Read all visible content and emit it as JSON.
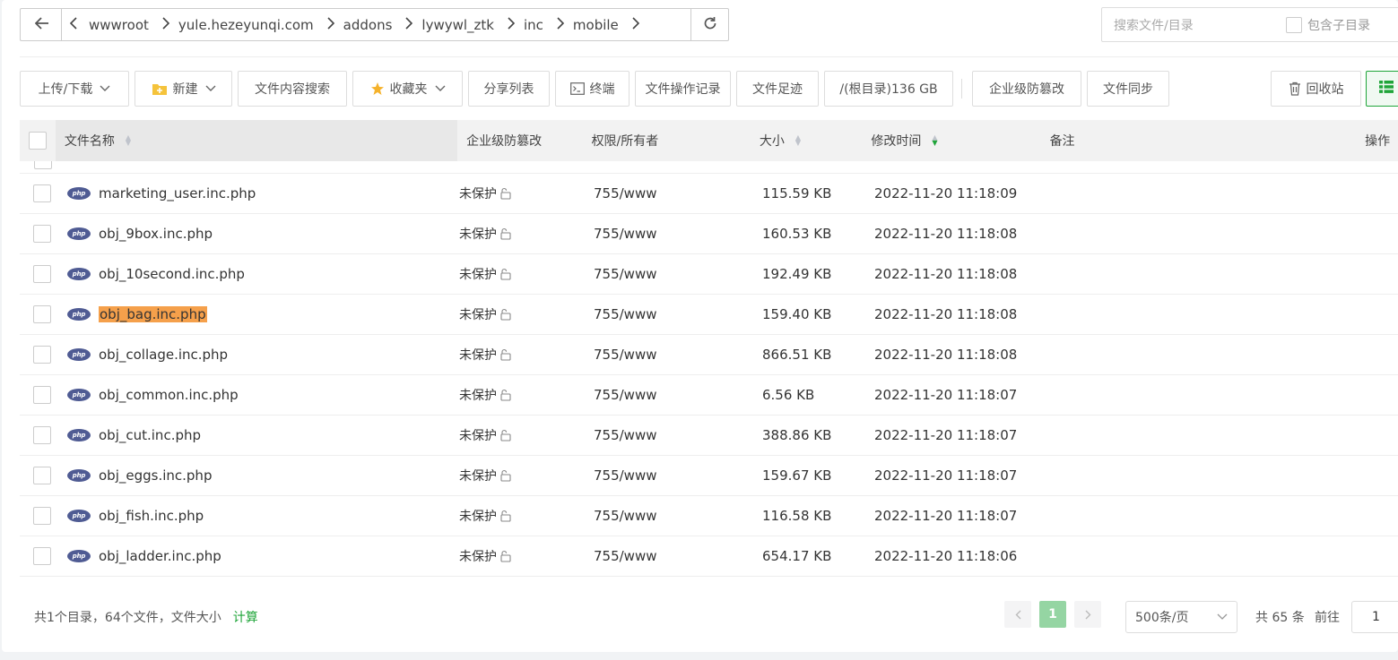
{
  "nav": {
    "path": [
      "wwwroot",
      "yule.hezeyunqi.com",
      "addons",
      "lywywl_ztk",
      "inc",
      "mobile"
    ],
    "search_placeholder": "搜索文件/目录",
    "include_subdir_label": "包含子目录"
  },
  "toolbar": {
    "upload": "上传/下载",
    "new": "新建",
    "content_search": "文件内容搜索",
    "favorites": "收藏夹",
    "share_list": "分享列表",
    "terminal": "终端",
    "op_log": "文件操作记录",
    "footprint": "文件足迹",
    "disk": "/(根目录)136 GB",
    "tamper": "企业级防篡改",
    "sync": "文件同步",
    "recycle": "回收站"
  },
  "table": {
    "headers": {
      "name": "文件名称",
      "protect": "企业级防篡改",
      "perm": "权限/所有者",
      "size": "大小",
      "mtime": "修改时间",
      "note": "备注",
      "op": "操作"
    },
    "rows": [
      {
        "name": "marketing_user.inc.php",
        "protect": "未保护",
        "perm": "755/www",
        "size": "115.59 KB",
        "mtime": "2022-11-20 11:18:09",
        "highlight": false
      },
      {
        "name": "obj_9box.inc.php",
        "protect": "未保护",
        "perm": "755/www",
        "size": "160.53 KB",
        "mtime": "2022-11-20 11:18:08",
        "highlight": false
      },
      {
        "name": "obj_10second.inc.php",
        "protect": "未保护",
        "perm": "755/www",
        "size": "192.49 KB",
        "mtime": "2022-11-20 11:18:08",
        "highlight": false
      },
      {
        "name": "obj_bag.inc.php",
        "protect": "未保护",
        "perm": "755/www",
        "size": "159.40 KB",
        "mtime": "2022-11-20 11:18:08",
        "highlight": true
      },
      {
        "name": "obj_collage.inc.php",
        "protect": "未保护",
        "perm": "755/www",
        "size": "866.51 KB",
        "mtime": "2022-11-20 11:18:08",
        "highlight": false
      },
      {
        "name": "obj_common.inc.php",
        "protect": "未保护",
        "perm": "755/www",
        "size": "6.56 KB",
        "mtime": "2022-11-20 11:18:07",
        "highlight": false
      },
      {
        "name": "obj_cut.inc.php",
        "protect": "未保护",
        "perm": "755/www",
        "size": "388.86 KB",
        "mtime": "2022-11-20 11:18:07",
        "highlight": false
      },
      {
        "name": "obj_eggs.inc.php",
        "protect": "未保护",
        "perm": "755/www",
        "size": "159.67 KB",
        "mtime": "2022-11-20 11:18:07",
        "highlight": false
      },
      {
        "name": "obj_fish.inc.php",
        "protect": "未保护",
        "perm": "755/www",
        "size": "116.58 KB",
        "mtime": "2022-11-20 11:18:07",
        "highlight": false
      },
      {
        "name": "obj_ladder.inc.php",
        "protect": "未保护",
        "perm": "755/www",
        "size": "654.17 KB",
        "mtime": "2022-11-20 11:18:06",
        "highlight": false
      }
    ]
  },
  "footer": {
    "summary": "共1个目录，64个文件，文件大小",
    "calc": "计算",
    "page": "1",
    "page_size": "500条/页",
    "total": "共 65 条",
    "goto": "前往",
    "goto_value": "1"
  },
  "colors": {
    "accent": "#20a53a",
    "highlight": "#f5a04b",
    "php_badge": "#4f5b93"
  }
}
